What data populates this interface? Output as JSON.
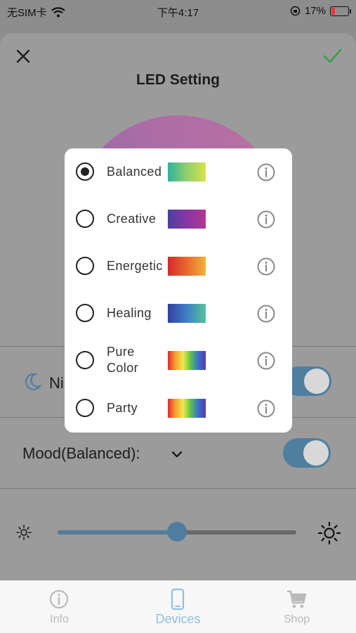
{
  "status_bar": {
    "carrier": "无SIM卡",
    "time": "下午4:17",
    "battery": "17%"
  },
  "sheet": {
    "title": "LED Setting",
    "night_label": "Ni",
    "mood_label": "Mood(Balanced):"
  },
  "brightness": {
    "level": 0.5
  },
  "popup": {
    "options": [
      {
        "label": "Balanced",
        "checked": true,
        "gradient": [
          "#2fb2a0",
          "#8fd06a",
          "#d8e24b"
        ]
      },
      {
        "label": "Creative",
        "checked": false,
        "gradient": [
          "#4a3f9e",
          "#8a35a6",
          "#b1378f"
        ]
      },
      {
        "label": "Energetic",
        "checked": false,
        "gradient": [
          "#d42a2a",
          "#e8682d",
          "#f2b33a"
        ]
      },
      {
        "label": "Healing",
        "checked": false,
        "gradient": [
          "#3340a0",
          "#3f7fc6",
          "#55c39a"
        ]
      },
      {
        "label": "Pure\nColor",
        "checked": false,
        "gradient": [
          "#e02b2b",
          "#f2a12d",
          "#f2e84a",
          "#5cc24a",
          "#3a6fd0",
          "#5a3aa8"
        ]
      },
      {
        "label": "Party",
        "checked": false,
        "gradient": [
          "#e02b2b",
          "#f2a12d",
          "#f2e84a",
          "#5cc24a",
          "#3a6fd0",
          "#5a3aa8"
        ]
      }
    ]
  },
  "tabs": [
    {
      "label": "Info",
      "active": false,
      "icon": "info-icon"
    },
    {
      "label": "Devices",
      "active": true,
      "icon": "phone-icon"
    },
    {
      "label": "Shop",
      "active": false,
      "icon": "cart-icon"
    }
  ],
  "colors": {
    "accent": "#4f7da0",
    "active_tab": "#8fbfe0",
    "confirm": "#3d9b4a"
  }
}
